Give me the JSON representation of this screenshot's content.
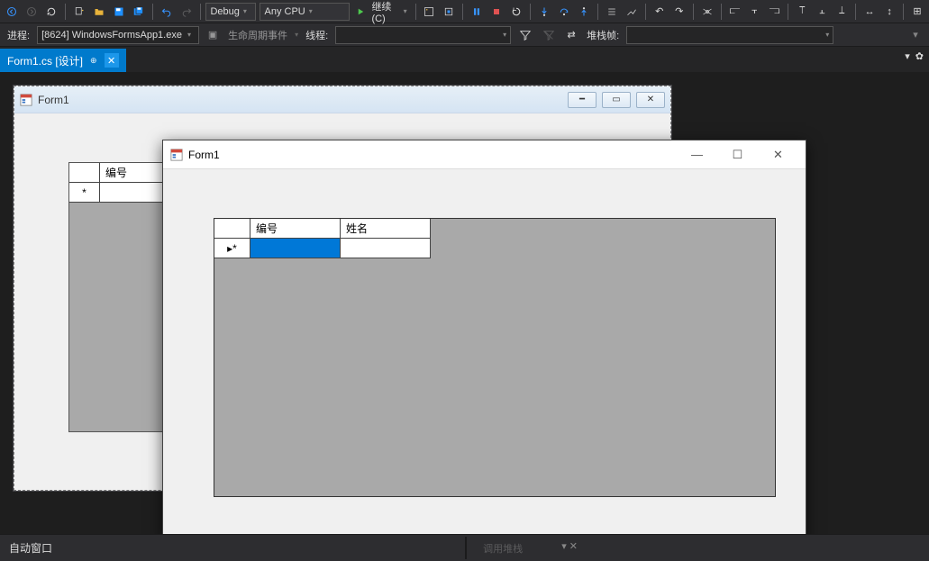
{
  "toolbar": {
    "config_dropdown": "Debug",
    "platform_dropdown": "Any CPU",
    "continue_label": "继续(C)"
  },
  "toolbar2": {
    "process_label": "进程:",
    "process_value": "[8624] WindowsFormsApp1.exe",
    "lifecycle_label": "生命周期事件",
    "thread_label": "线程:",
    "stackframe_label": "堆栈帧:"
  },
  "tab": {
    "title": "Form1.cs [设计]"
  },
  "designer": {
    "title": "Form1",
    "grid": {
      "col1": "编号",
      "newrow_marker": "*"
    }
  },
  "runtime": {
    "title": "Form1",
    "grid": {
      "col1": "编号",
      "col2": "姓名",
      "newrow_marker": "▸*"
    }
  },
  "bottom": {
    "autowindow_label": "自动窗口",
    "callstack_label": "调用堆栈"
  }
}
